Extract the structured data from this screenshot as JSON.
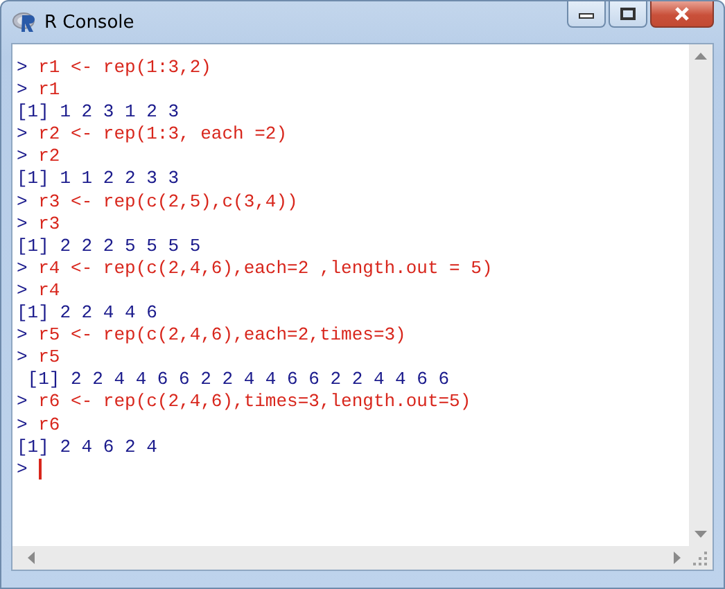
{
  "window": {
    "title": "R Console"
  },
  "console": {
    "lines": [
      {
        "kind": "input",
        "prompt": ">",
        "text": "r1 <- rep(1:3,2)"
      },
      {
        "kind": "input",
        "prompt": ">",
        "text": "r1"
      },
      {
        "kind": "output",
        "text": "[1] 1 2 3 1 2 3"
      },
      {
        "kind": "input",
        "prompt": ">",
        "text": "r2 <- rep(1:3, each =2)"
      },
      {
        "kind": "input",
        "prompt": ">",
        "text": "r2"
      },
      {
        "kind": "output",
        "text": "[1] 1 1 2 2 3 3"
      },
      {
        "kind": "input",
        "prompt": ">",
        "text": "r3 <- rep(c(2,5),c(3,4))"
      },
      {
        "kind": "input",
        "prompt": ">",
        "text": "r3"
      },
      {
        "kind": "output",
        "text": "[1] 2 2 2 5 5 5 5"
      },
      {
        "kind": "input",
        "prompt": ">",
        "text": "r4 <- rep(c(2,4,6),each=2 ,length.out = 5)"
      },
      {
        "kind": "input",
        "prompt": ">",
        "text": "r4"
      },
      {
        "kind": "output",
        "text": "[1] 2 2 4 4 6"
      },
      {
        "kind": "input",
        "prompt": ">",
        "text": "r5 <- rep(c(2,4,6),each=2,times=3)"
      },
      {
        "kind": "input",
        "prompt": ">",
        "text": "r5"
      },
      {
        "kind": "output",
        "text": " [1] 2 2 4 4 6 6 2 2 4 4 6 6 2 2 4 4 6 6"
      },
      {
        "kind": "input",
        "prompt": ">",
        "text": "r6 <- rep(c(2,4,6),times=3,length.out=5)"
      },
      {
        "kind": "input",
        "prompt": ">",
        "text": "r6"
      },
      {
        "kind": "output",
        "text": "[1] 2 4 6 2 4"
      },
      {
        "kind": "input",
        "prompt": ">",
        "cursor": true
      }
    ]
  }
}
